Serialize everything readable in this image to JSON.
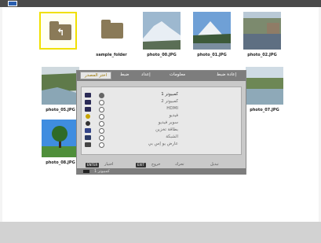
{
  "files": [
    {
      "caption": ""
    },
    {
      "caption": "sample_folder"
    },
    {
      "caption": "photo_00.JPG"
    },
    {
      "caption": "photo_01.JPG"
    },
    {
      "caption": "photo_02.JPG"
    },
    {
      "caption": "photo_05.JPG"
    },
    {
      "caption": "photo_07.JPG"
    },
    {
      "caption": "photo_08.JPG"
    }
  ],
  "menu": {
    "tabs": [
      "اختر المصدر",
      "ضبط",
      "إعداد",
      "معلومات",
      "إعادة ضبط"
    ],
    "sources": [
      {
        "label": "كمبيوتر 1",
        "icon": "computer-icon",
        "selected": true
      },
      {
        "label": "كمبيوتر 2",
        "icon": "computer-icon",
        "selected": false
      },
      {
        "label": "HDMI",
        "icon": "hdmi-icon",
        "selected": false
      },
      {
        "label": "فيديو",
        "icon": "video-icon",
        "selected": false
      },
      {
        "label": "سوبر فيديو",
        "icon": "s-video-icon",
        "selected": false
      },
      {
        "label": "بطاقة تخزين",
        "icon": "card-icon",
        "selected": false
      },
      {
        "label": "الشبكة",
        "icon": "network-icon",
        "selected": false
      },
      {
        "label": "عارض يو إس بي",
        "icon": "usb-icon",
        "selected": false
      }
    ],
    "help": {
      "enter_key": "ENTER",
      "enter_text": "اختيار",
      "exit_key": "EXIT",
      "exit_text": "خروج",
      "move_text": "تحرك",
      "select_text": "تبديل"
    },
    "footer": "كمبيوتر 1"
  }
}
